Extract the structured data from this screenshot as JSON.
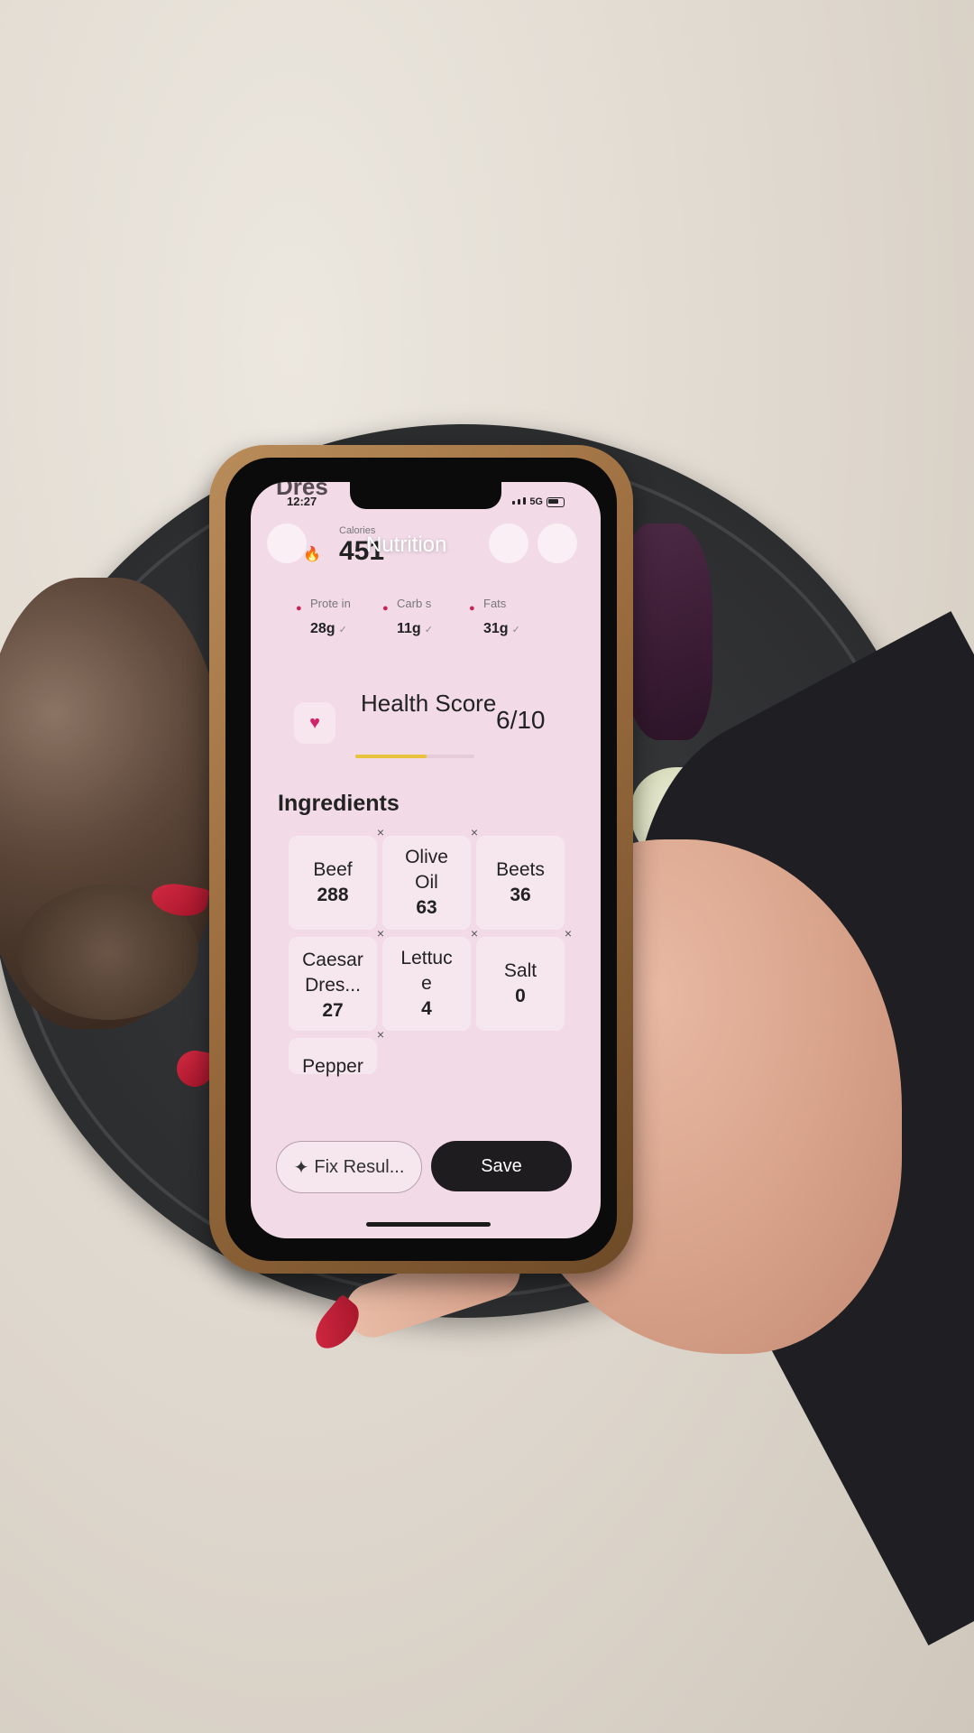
{
  "status_bar": {
    "time": "12:27",
    "network": "5G"
  },
  "header": {
    "title": "Nutrition",
    "partial_name": "Dres"
  },
  "calories": {
    "label": "Calories",
    "value": "451"
  },
  "macros": [
    {
      "label": "Prote in",
      "value": "28g"
    },
    {
      "label": "Carb s",
      "value": "11g"
    },
    {
      "label": "Fats",
      "value": "31g"
    }
  ],
  "health": {
    "label": "Health Score",
    "score": "6/10",
    "level": 0.6
  },
  "ingredients": {
    "title": "Ingredients",
    "items": [
      {
        "name": "Beef",
        "calories": "288"
      },
      {
        "name": "Olive Oil",
        "calories": "63"
      },
      {
        "name": "Beets",
        "calories": "36"
      },
      {
        "name": "Caesar Dres...",
        "calories": "27"
      },
      {
        "name": "Lettuc e",
        "calories": "4"
      },
      {
        "name": "Salt",
        "calories": "0"
      },
      {
        "name": "Pepper",
        "calories": ""
      }
    ]
  },
  "actions": {
    "fix_label": "Fix Resul...",
    "save_label": "Save"
  },
  "colors": {
    "screen_bg": "#f2dbe6",
    "score_bar": "#e7c23a",
    "nail": "#c8203a",
    "save_bg": "#1e1c1f"
  }
}
